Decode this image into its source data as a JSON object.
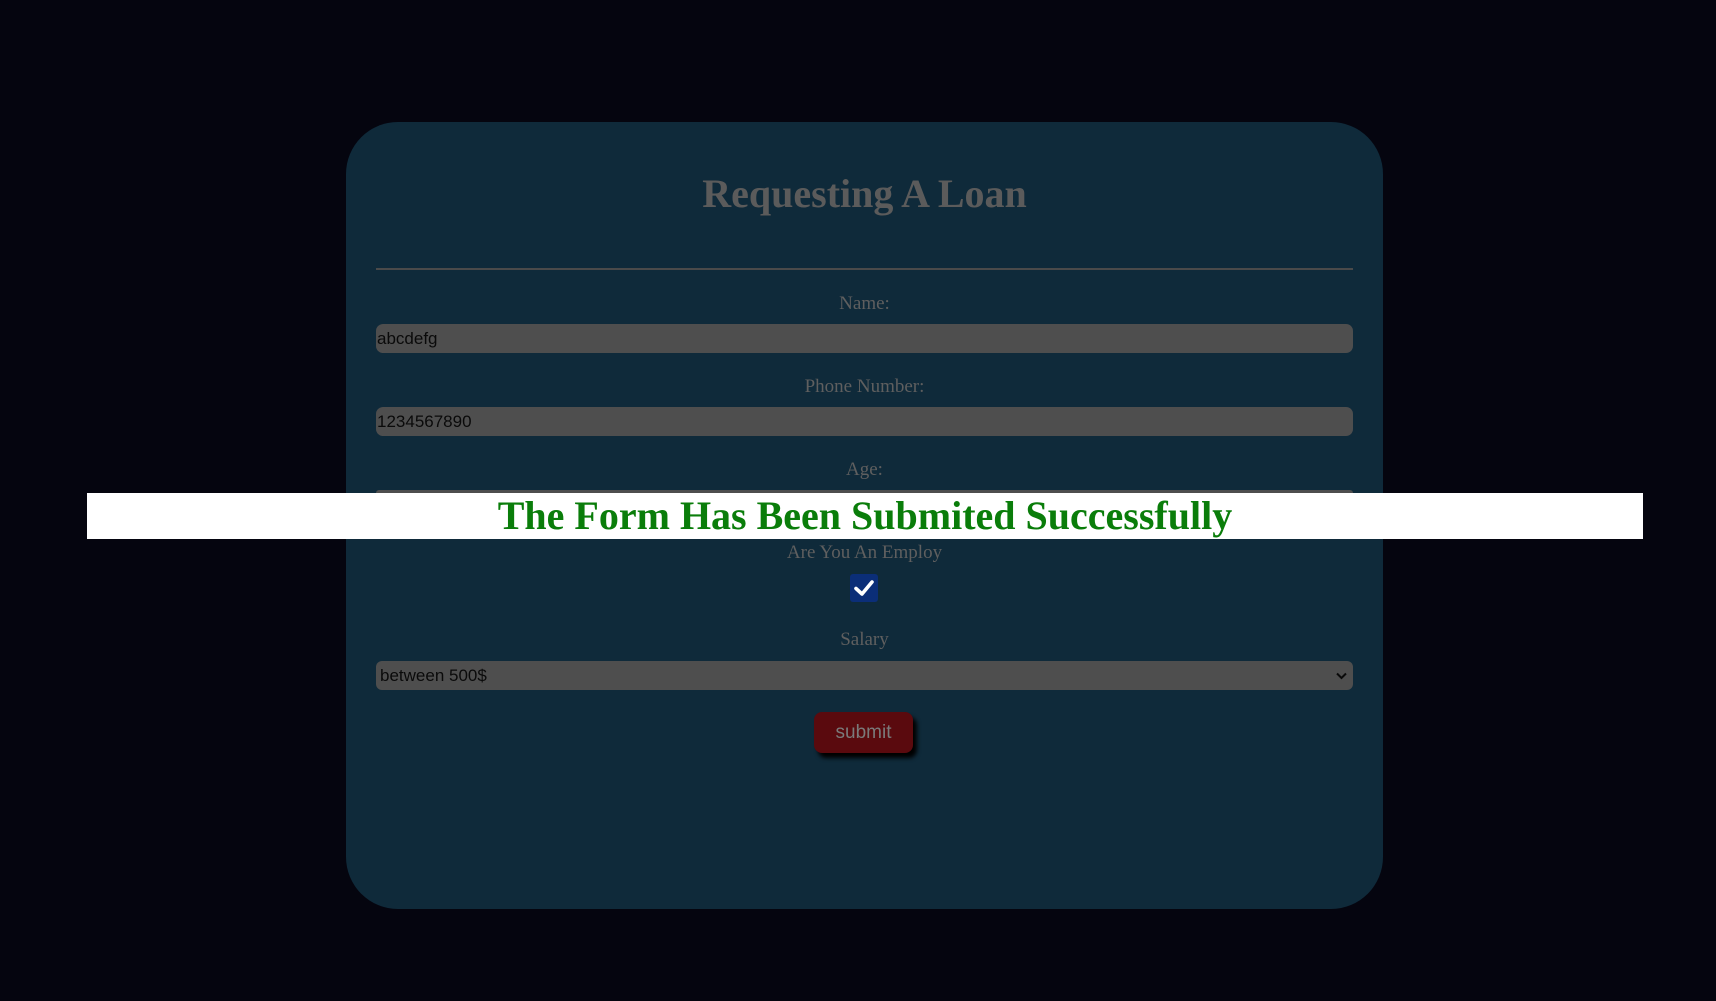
{
  "form": {
    "title": "Requesting A Loan",
    "name_label": "Name:",
    "name_value": "abcdefg",
    "phone_label": "Phone Number:",
    "phone_value": "1234567890",
    "age_label": "Age:",
    "employ_label": "Are You An Employ",
    "employ_checked": true,
    "salary_label": "Salary",
    "salary_value": "between 500$",
    "submit_label": "submit"
  },
  "banner": {
    "message": "The Form Has Been Submited Successfully"
  },
  "colors": {
    "page_background": "#05050f",
    "card_background": "#0f2a3a",
    "input_background": "#4e4e4e",
    "submit_background": "#5a0a0e",
    "success_text": "#0a7d0a",
    "checkbox_fill": "#0b2e78"
  },
  "icons": {
    "checkbox": "checkmark-icon",
    "select": "chevron-down-icon"
  }
}
